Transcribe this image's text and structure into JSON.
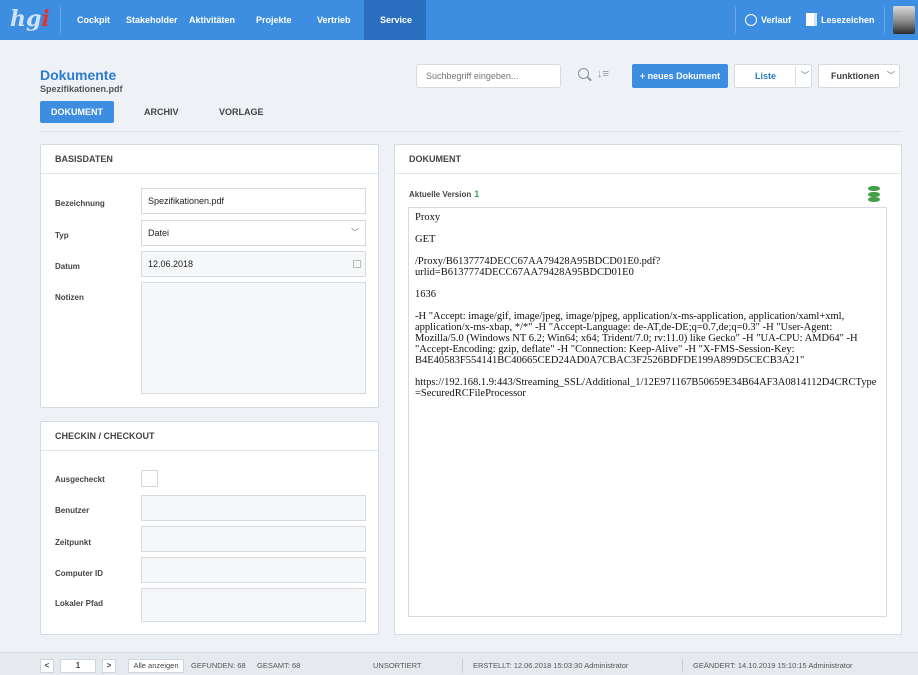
{
  "nav": {
    "logo": "hgi",
    "items": [
      "Cockpit",
      "Stakeholder",
      "Aktivitäten",
      "Projekte",
      "Vertrieb",
      "Service"
    ],
    "active": "Service",
    "verlauf": "Verlauf",
    "lesezeichen": "Lesezeichen"
  },
  "header": {
    "title": "Dokumente",
    "subtitle": "Spezifikationen.pdf",
    "search_placeholder": "Suchbegriff eingeben...",
    "sort_glyph": "↓≡",
    "new_button": "+ neues Dokument",
    "view_select": "Liste",
    "functions": "Funktionen"
  },
  "tabs": [
    "DOKUMENT",
    "ARCHIV",
    "VORLAGE"
  ],
  "basisdaten": {
    "title": "BASISDATEN",
    "labels": {
      "bezeichnung": "Bezeichnung",
      "typ": "Typ",
      "datum": "Datum",
      "notizen": "Notizen"
    },
    "values": {
      "bezeichnung": "Spezifikationen.pdf",
      "typ": "Datei",
      "datum": "12.06.2018",
      "notizen": ""
    }
  },
  "checkin": {
    "title": "CHECKIN / CHECKOUT",
    "labels": {
      "ausgecheckt": "Ausgecheckt",
      "benutzer": "Benutzer",
      "zeitpunkt": "Zeitpunkt",
      "computer_id": "Computer ID",
      "lokaler_pfad": "Lokaler Pfad"
    },
    "values": {
      "ausgecheckt": false,
      "benutzer": "",
      "zeitpunkt": "",
      "computer_id": "",
      "lokaler_pfad": ""
    }
  },
  "dokument": {
    "title": "DOKUMENT",
    "version_label": "Aktuelle Version",
    "version": "1",
    "content": [
      "Proxy",
      "GET",
      "/Proxy/B6137774DECC67AA79428A95BDCD01E0.pdf?\nurlid=B6137774DECC67AA79428A95BDCD01E0",
      "1636",
      "-H \"Accept: image/gif, image/jpeg, image/pjpeg, application/x-ms-application, application/xaml+xml, application/x-ms-xbap, */*\" -H \"Accept-Language: de-AT,de-DE;q=0.7,de;q=0.3\" -H \"User-Agent: Mozilla/5.0 (Windows NT 6.2; Win64; x64; Trident/7.0; rv:11.0) like Gecko\" -H \"UA-CPU: AMD64\" -H \"Accept-Encoding: gzip, deflate\" -H \"Connection: Keep-Alive\" -H \"X-FMS-Session-Key: B4E40583F554141BC40665CED24AD0A7CBAC3F2526BDFDE199A899D5CECB3A21\"",
      "https://192.168.1.9:443/Streaming_SSL/Additional_1/12E971167B50659E34B64AF3A0814112D4CRCType=SecuredRCFileProcessor"
    ]
  },
  "footer": {
    "prev": "<",
    "page": "1",
    "next": ">",
    "show_all": "Alle anzeigen",
    "found": "GEFUNDEN: 68",
    "total": "GESAMT: 68",
    "sort": "UNSORTIERT",
    "created": "ERSTELLT:  12.06.2018 15:03:30   Administrator",
    "modified": "GEÄNDERT:  14.10.2019 15:10:15   Administrator"
  }
}
